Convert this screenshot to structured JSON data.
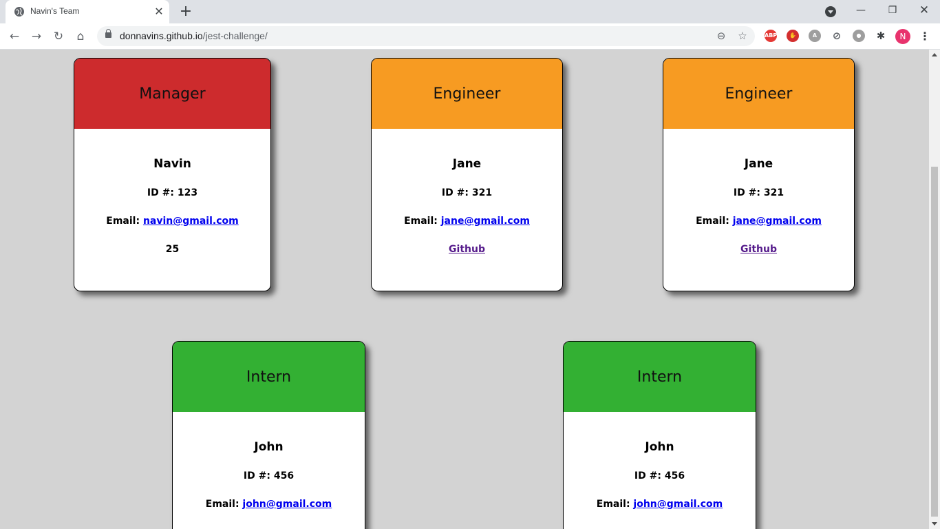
{
  "browser": {
    "tab_title": "Navin's Team",
    "url_host": "donnavins.github.io",
    "url_path": "/jest-challenge/",
    "profile_initial": "N",
    "extensions": [
      {
        "name": "adblock-plus-icon",
        "label": "ABP",
        "color": "#e53935"
      },
      {
        "name": "hand-stop-icon",
        "label": "✋",
        "color": "#d32f2f"
      },
      {
        "name": "translate-icon",
        "label": "A",
        "color": "#9e9e9e"
      },
      {
        "name": "block-icon",
        "label": "⊘",
        "color": "#5f6368"
      },
      {
        "name": "password-icon",
        "label": "●",
        "color": "#9e9e9e"
      },
      {
        "name": "puzzle-icon",
        "label": "✱",
        "color": "#3c4043"
      }
    ]
  },
  "cards": [
    {
      "role": "Manager",
      "name": "Navin",
      "id_label": "ID #:",
      "id": "123",
      "email_label": "Email:",
      "email": "navin@gmail.com",
      "extra": "25"
    },
    {
      "role": "Engineer",
      "name": "Jane",
      "id_label": "ID #:",
      "id": "321",
      "email_label": "Email:",
      "email": "jane@gmail.com",
      "extra": "Github"
    },
    {
      "role": "Engineer",
      "name": "Jane",
      "id_label": "ID #:",
      "id": "321",
      "email_label": "Email:",
      "email": "jane@gmail.com",
      "extra": "Github"
    },
    {
      "role": "Intern",
      "name": "John",
      "id_label": "ID #:",
      "id": "456",
      "email_label": "Email:",
      "email": "john@gmail.com"
    },
    {
      "role": "Intern",
      "name": "John",
      "id_label": "ID #:",
      "id": "456",
      "email_label": "Email:",
      "email": "john@gmail.com"
    }
  ],
  "colors": {
    "manager": "#cd2b2d",
    "engineer": "#f79b22",
    "intern": "#33b033",
    "page_background": "#d3d3d3"
  }
}
